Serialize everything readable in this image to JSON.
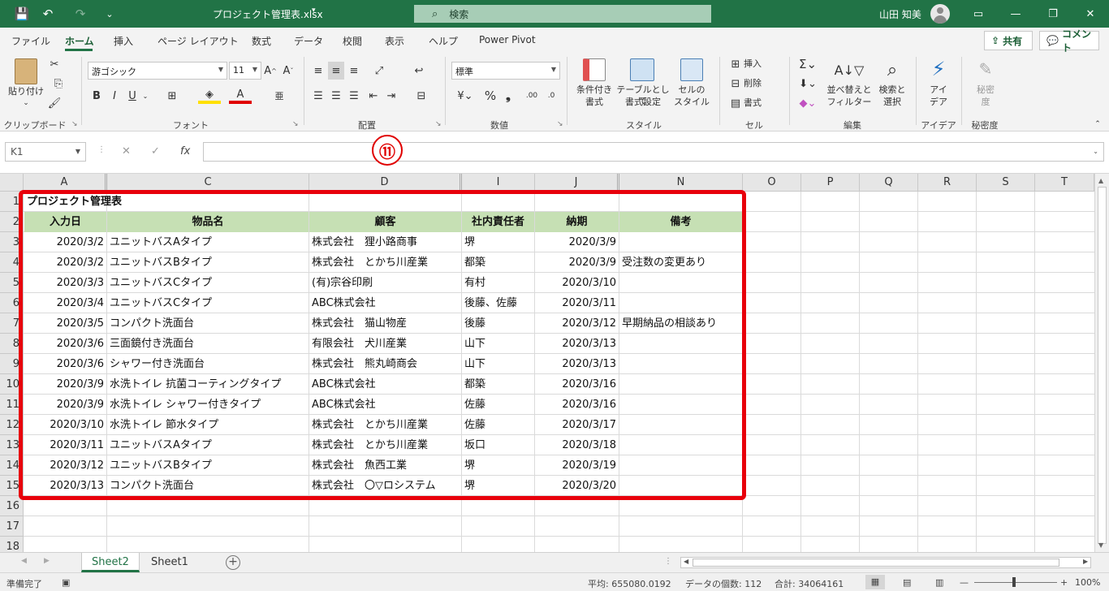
{
  "titlebar": {
    "doc_title": "プロジェクト管理表.xlsx",
    "title_caret": "▾",
    "search_placeholder": "検索",
    "user_name": "山田 知美",
    "accent_color": "#217346"
  },
  "menu": {
    "tabs": [
      "ファイル",
      "ホーム",
      "挿入",
      "ページ レイアウト",
      "数式",
      "データ",
      "校閲",
      "表示",
      "ヘルプ",
      "Power Pivot"
    ],
    "active_tab": "ホーム",
    "share_label": "共有",
    "comment_label": "コメント"
  },
  "ribbon": {
    "groups": {
      "clipboard": "クリップボード",
      "font": "フォント",
      "alignment": "配置",
      "number": "数値",
      "styles": "スタイル",
      "cells": "セル",
      "editing": "編集",
      "ideas": "アイデア",
      "sensitivity": "秘密度"
    },
    "paste_label_1": "貼り付け",
    "paste_label_2": "け",
    "font_name": "游ゴシック",
    "font_size": "11",
    "bold": "B",
    "italic": "I",
    "underline": "U",
    "number_format": "標準",
    "percent": "%",
    "comma": "❟",
    "cond_format_1": "条件付き",
    "cond_format_2": "書式",
    "table_format_1": "テーブルとして",
    "table_format_2": "書式設定",
    "cell_style_1": "セルの",
    "cell_style_2": "スタイル",
    "insert": "挿入",
    "delete": "削除",
    "format": "書式",
    "sort_filter_1": "並べ替えと",
    "sort_filter_2": "フィルター",
    "find_select_1": "検索と",
    "find_select_2": "選択",
    "ideas_1": "アイ",
    "ideas_2": "デア",
    "sensitivity_1": "秘密",
    "sensitivity_2": "度"
  },
  "formula_bar": {
    "name_box": "K1",
    "fx": "fx",
    "formula": ""
  },
  "annotation": {
    "marker": "⑪",
    "color": "#e8000b"
  },
  "sheet": {
    "col_headers": [
      "A",
      "C",
      "D",
      "I",
      "J",
      "N",
      "O",
      "P",
      "Q",
      "R",
      "S",
      "T"
    ],
    "row_headers": [
      "1",
      "2",
      "3",
      "4",
      "5",
      "6",
      "7",
      "8",
      "9",
      "10",
      "11",
      "12",
      "13",
      "14",
      "15",
      "16",
      "17",
      "18"
    ],
    "title": "プロジェクト管理表",
    "headers": [
      "入力日",
      "物品名",
      "顧客",
      "社内責任者",
      "納期",
      "備考"
    ],
    "header_fill": "#c6e0b4",
    "rows": [
      [
        "2020/3/2",
        "ユニットバスAタイプ",
        "株式会社　狸小路商事",
        "堺",
        "2020/3/9",
        ""
      ],
      [
        "2020/3/2",
        "ユニットバスBタイプ",
        "株式会社　とかち川産業",
        "都築",
        "2020/3/9",
        "受注数の変更あり"
      ],
      [
        "2020/3/3",
        "ユニットバスCタイプ",
        "(有)宗谷印刷",
        "有村",
        "2020/3/10",
        ""
      ],
      [
        "2020/3/4",
        "ユニットバスCタイプ",
        "ABC株式会社",
        "後藤、佐藤",
        "2020/3/11",
        ""
      ],
      [
        "2020/3/5",
        "コンパクト洗面台",
        "株式会社　猫山物産",
        "後藤",
        "2020/3/12",
        "早期納品の相談あり"
      ],
      [
        "2020/3/6",
        "三面鏡付き洗面台",
        "有限会社　犬川産業",
        "山下",
        "2020/3/13",
        ""
      ],
      [
        "2020/3/6",
        "シャワー付き洗面台",
        "株式会社　熊丸崎商会",
        "山下",
        "2020/3/13",
        ""
      ],
      [
        "2020/3/9",
        "水洗トイレ 抗菌コーティングタイプ",
        "ABC株式会社",
        "都築",
        "2020/3/16",
        ""
      ],
      [
        "2020/3/9",
        "水洗トイレ シャワー付きタイプ",
        "ABC株式会社",
        "佐藤",
        "2020/3/16",
        ""
      ],
      [
        "2020/3/10",
        "水洗トイレ 節水タイプ",
        "株式会社　とかち川産業",
        "佐藤",
        "2020/3/17",
        ""
      ],
      [
        "2020/3/11",
        "ユニットバスAタイプ",
        "株式会社　とかち川産業",
        "坂口",
        "2020/3/18",
        ""
      ],
      [
        "2020/3/12",
        "ユニットバスBタイプ",
        "株式会社　魚西工業",
        "堺",
        "2020/3/19",
        ""
      ],
      [
        "2020/3/13",
        "コンパクト洗面台",
        "株式会社　〇▽ロシステム",
        "堺",
        "2020/3/20",
        ""
      ]
    ]
  },
  "tabs": {
    "sheets": [
      "Sheet2",
      "Sheet1"
    ],
    "active": "Sheet2",
    "add": "+"
  },
  "status": {
    "ready": "準備完了",
    "average": "平均: 655080.0192",
    "count": "データの個数: 112",
    "sum": "合計: 34064161",
    "zoom": "100%"
  }
}
